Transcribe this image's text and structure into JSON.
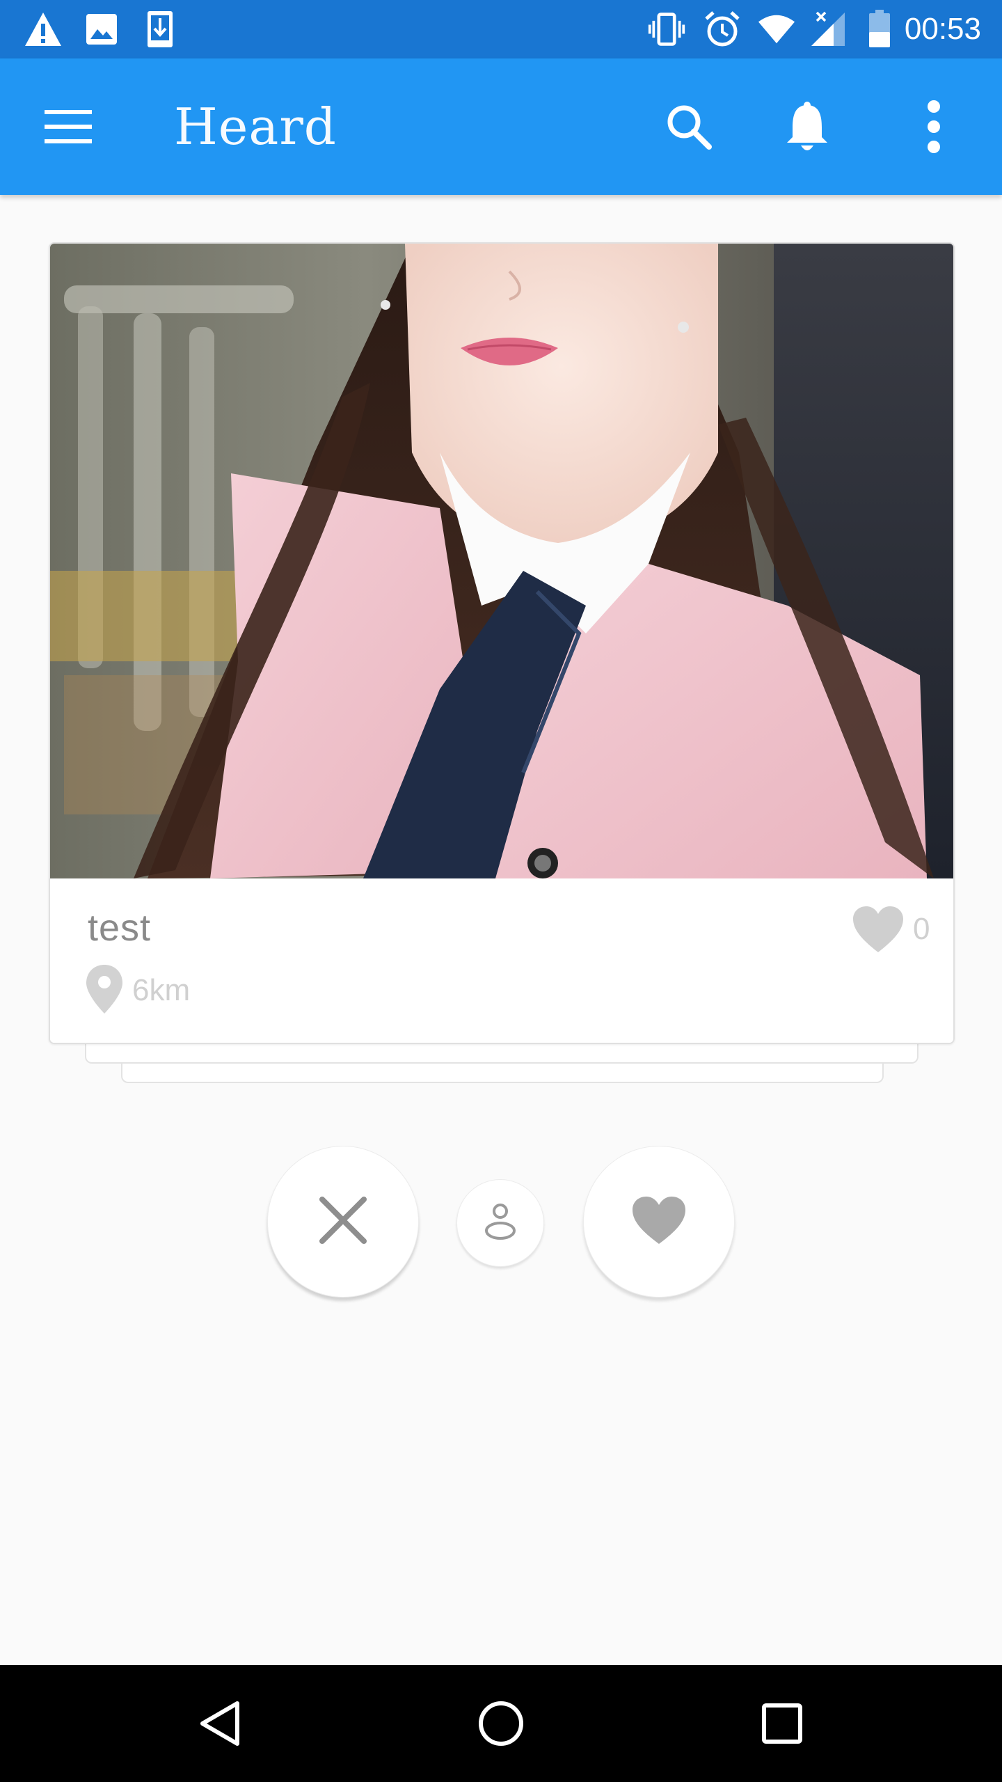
{
  "status_bar": {
    "time": "00:53",
    "left_icons": [
      "warning-icon",
      "image-icon",
      "download-icon"
    ],
    "right_icons": [
      "vibrate-icon",
      "alarm-icon",
      "wifi-icon",
      "signal-icon",
      "battery-icon"
    ]
  },
  "app_bar": {
    "title": "Heard",
    "icons": [
      "menu-icon",
      "search-icon",
      "bell-icon",
      "more-vert-icon"
    ]
  },
  "card": {
    "photo": "profile-photo",
    "name": "test",
    "distance": "6km",
    "likes": "0"
  },
  "actions": [
    "pass-button",
    "profile-button",
    "like-button"
  ],
  "nav_bar": {
    "icons": [
      "back-icon",
      "home-icon",
      "recents-icon"
    ]
  },
  "colors": {
    "status_bar": "#1976d2",
    "app_bar": "#2196f3",
    "background": "#fafafa",
    "muted_text": "#8a8a8a",
    "faint_text": "#d0d0d0",
    "icon_gray": "#a9a9a9"
  }
}
